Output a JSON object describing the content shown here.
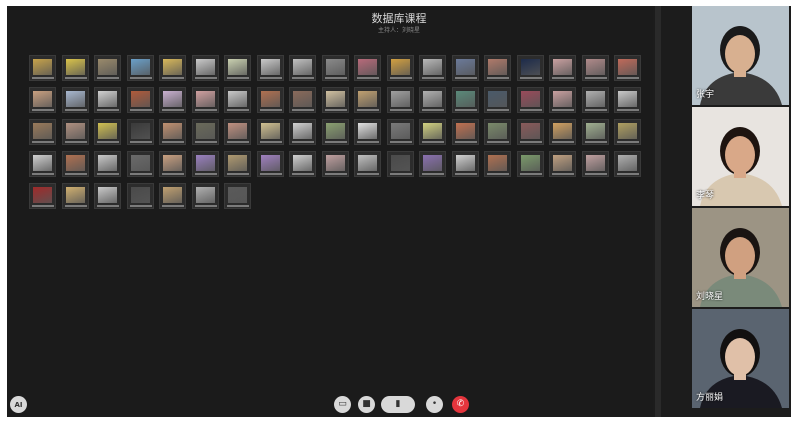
{
  "meeting": {
    "title": "数据库课程",
    "subtitle": "主持人：刘晓星"
  },
  "participant_grid": {
    "rows": [
      [
        "#c7a34a",
        "#d9c34a",
        "#9a8a6b",
        "#6aa0c9",
        "#d8b85a",
        "#c9c9c9",
        "#c9d0b0",
        "#c9c9c9",
        "#c0c0c0",
        "#8a8a8a",
        "#b86a7a",
        "#d2a040",
        "#b8b8b8",
        "#6b7a9a",
        "#b07a6a",
        "#1d2b4a",
        "#c9a0a0",
        "#b08a8a",
        "#c06a5a"
      ],
      [
        "#c9a080",
        "#a8b8d0",
        "#d0d0d0",
        "#b05a3a",
        "#c9b0d0",
        "#d0a0a0",
        "#c9c9c9",
        "#b07050",
        "#8a6a5a",
        "#d0c0a0",
        "#c0a070",
        "#a0a0a0",
        "#b0b0b0",
        "#5a8a7a",
        "#4a5a6a",
        "#9a4a5a",
        "#c9a0a0",
        "#b0b0b0",
        "#c9c9c9"
      ],
      [
        "#9a7a5a",
        "#b09080",
        "#d0c050",
        "#3a3a3a",
        "#c09070",
        "#6a6a5a",
        "#c09080",
        "#d0c090",
        "#d0d0d0",
        "#8aa070",
        "#e0e0e0",
        "#7a7a7a",
        "#d0d080",
        "#c07050",
        "#7a8a6a",
        "#8a5a5a",
        "#d0a060",
        "#a0b090",
        "#b0a060"
      ],
      [
        "#d0d0d0",
        "#b07050",
        "#c9c9c9",
        "#6a6a6a",
        "#c9a080",
        "#9a80c0",
        "#b09a70",
        "#a080c0",
        "#d0d0d0",
        "#c0a0a0",
        "#c0c0c0",
        "#4a4a4a",
        "#8a70b0",
        "#d0d0d0",
        "#b07050",
        "#7a9a6a",
        "#c0a080",
        "#c0a0a0",
        "#b0b0b0"
      ],
      [
        "#a02a2a",
        "#d0b070",
        "#c9c9c9",
        "#4a4a4a",
        "#c0a070",
        "#b0b0b0",
        "#5a5a5a"
      ]
    ]
  },
  "controls": {
    "user_avatar_label": "AI",
    "buttons": [
      {
        "icon": "chat-icon",
        "glyph": "▭"
      },
      {
        "icon": "camera-icon",
        "glyph": "■"
      },
      {
        "icon": "mic-icon",
        "glyph": "▮"
      },
      {
        "icon": "more-icon",
        "glyph": "•"
      },
      {
        "icon": "end-call-icon",
        "glyph": "✆"
      }
    ]
  },
  "videos": [
    {
      "name": "张宇",
      "bg": "#b8c4cc",
      "skin": "#d8b090",
      "shirt": "#3a3a3a",
      "hair": "#1a1a1a"
    },
    {
      "name": "李琴",
      "bg": "#e8e4e0",
      "skin": "#d9a888",
      "shirt": "#d8c8b0",
      "hair": "#1e1410"
    },
    {
      "name": "刘晓星",
      "bg": "#9c9484",
      "skin": "#d0a080",
      "shirt": "#7a8a7a",
      "hair": "#1a1412"
    },
    {
      "name": "方丽娟",
      "bg": "#5a6470",
      "skin": "#e0c0a8",
      "shirt": "#1a1a22",
      "hair": "#121010"
    }
  ]
}
